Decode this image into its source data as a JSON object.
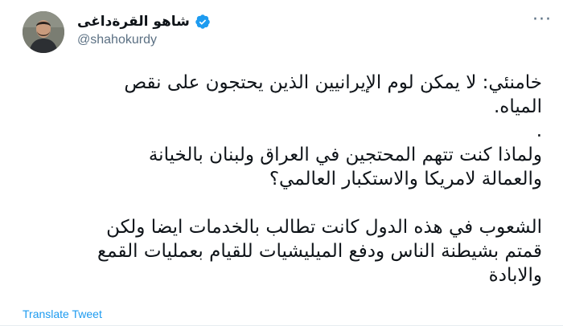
{
  "author": {
    "display_name": "شاهو القرةداغى",
    "handle": "@shahokurdy",
    "verified": true
  },
  "tweet": {
    "lines": [
      "خامنئي: لا يمكن لوم الإيرانيين الذين يحتجون على نقص",
      "المياه.",
      ".",
      "ولماذا كنت تتهم المحتجين في العراق ولبنان بالخيانة",
      "والعمالة لامريكا والاستكبار العالمي؟",
      "",
      "الشعوب في هذه الدول كانت تطالب بالخدمات ايضا ولكن",
      "قمتم بشيطنة الناس ودفع الميليشيات للقيام بعمليات القمع",
      "والابادة"
    ]
  },
  "actions": {
    "translate_label": "Translate Tweet"
  },
  "icons": {
    "more": "more-options-icon",
    "verified": "verified-badge-icon"
  },
  "colors": {
    "link": "#1d9bf0",
    "secondary": "#5b7083",
    "text": "#0f1419"
  }
}
